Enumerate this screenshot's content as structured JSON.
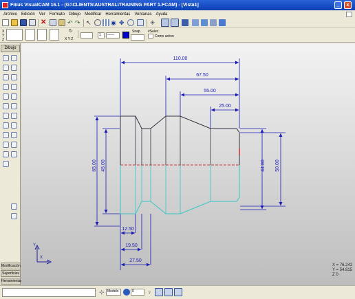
{
  "window": {
    "title": "Fikus VisualCAM 16.1 - (G:\\CLIENTS\\AUSTRAL\\TRAINING PART 1.FCAM) - [Vista1]",
    "minimize_glyph": "_",
    "close_glyph": "x"
  },
  "menu": [
    "Archivo",
    "Edición",
    "Ver",
    "Formato",
    "Dibujo",
    "Modificar",
    "Herramientas",
    "Ventanas",
    "Ayuda"
  ],
  "toolbar2": {
    "coord_labels": [
      "X",
      "Y",
      "Z"
    ],
    "line_width_value": "1",
    "line_style_glyph": "——",
    "snap_label": "Snap",
    "selec_label": "#Selec.",
    "como_activo_label": "Como activo",
    "layer_axis_label": "X Y Z"
  },
  "left_panel": {
    "tab_label": "Dibujo",
    "bottom_tabs": [
      "Modificación",
      "Superficies",
      "Herramientas"
    ]
  },
  "drawing": {
    "dimensions": {
      "total_length": "110.00",
      "length_67": "67.50",
      "length_55": "55.00",
      "length_25": "25.00",
      "dia_65": "65.00",
      "dia_45": "45.00",
      "dia_44": "44.80",
      "dia_50": "50.00",
      "len_12": "12.50",
      "len_19": "19.50",
      "len_27": "27.50"
    },
    "colors": {
      "dimension": "#1a1ab4",
      "part_outline": "#303040",
      "mirror_outline": "#34c7c7",
      "axis": "#cc0000",
      "origin_axis": "#1a1a9a"
    },
    "axis_labels": {
      "y": "Y",
      "x": "X"
    }
  },
  "coordinates": {
    "x": "X = 76.242",
    "y": "Y = 54.815",
    "z": "Z 0"
  },
  "statusbar": {
    "model_select": "Modelo",
    "layer_value": "0"
  }
}
